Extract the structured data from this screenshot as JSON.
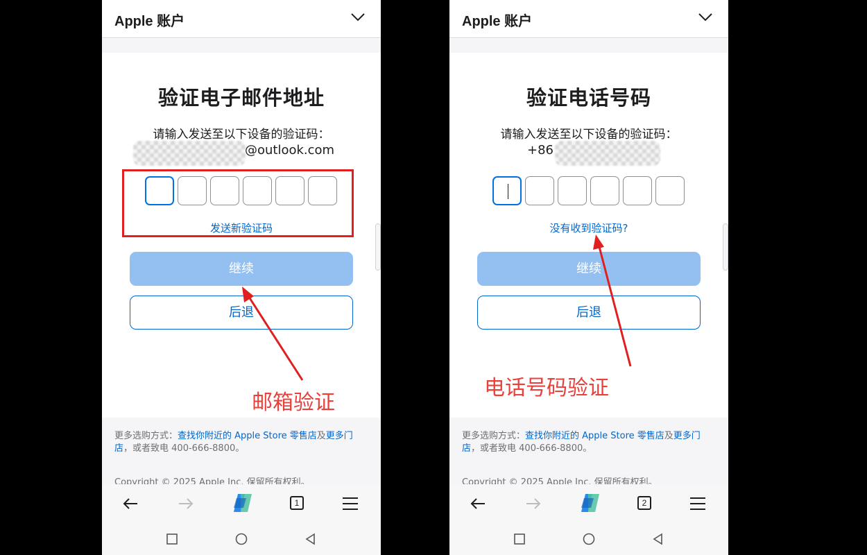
{
  "left": {
    "header": {
      "brand": "Apple 账户"
    },
    "title": "验证电子邮件地址",
    "subtitle": "请输入发送至以下设备的验证码：",
    "target": "@outlook.com",
    "link": "发送新验证码",
    "continue": "继续",
    "back": "后退",
    "footer": {
      "prefix": "更多选购方式：",
      "store_link": "查找你附近的 Apple Store 零售店",
      "and": "及",
      "more_link": "更多门店",
      "phone_text": "，或者致电 400-666-8800。",
      "copyright": "Copyright © 2025 Apple Inc. 保留所有权利。"
    },
    "tab_count": "1",
    "annotation": "邮箱验证"
  },
  "right": {
    "header": {
      "brand": "Apple 账户"
    },
    "title": "验证电话号码",
    "subtitle": "请输入发送至以下设备的验证码：",
    "target": "+86",
    "link": "没有收到验证码?",
    "continue": "继续",
    "back": "后退",
    "footer": {
      "prefix": "更多选购方式：",
      "store_link": "查找你附近的 Apple Store 零售店",
      "and": "及",
      "more_link": "更多门店",
      "phone_text": "，或者致电 400-666-8800。",
      "copyright": "Copyright © 2025 Apple Inc. 保留所有权利。"
    },
    "tab_count": "2",
    "annotation": "电话号码验证"
  },
  "colors": {
    "accent": "#0066cc",
    "annotation": "#e8413c",
    "button_disabled": "#93c0f1"
  }
}
